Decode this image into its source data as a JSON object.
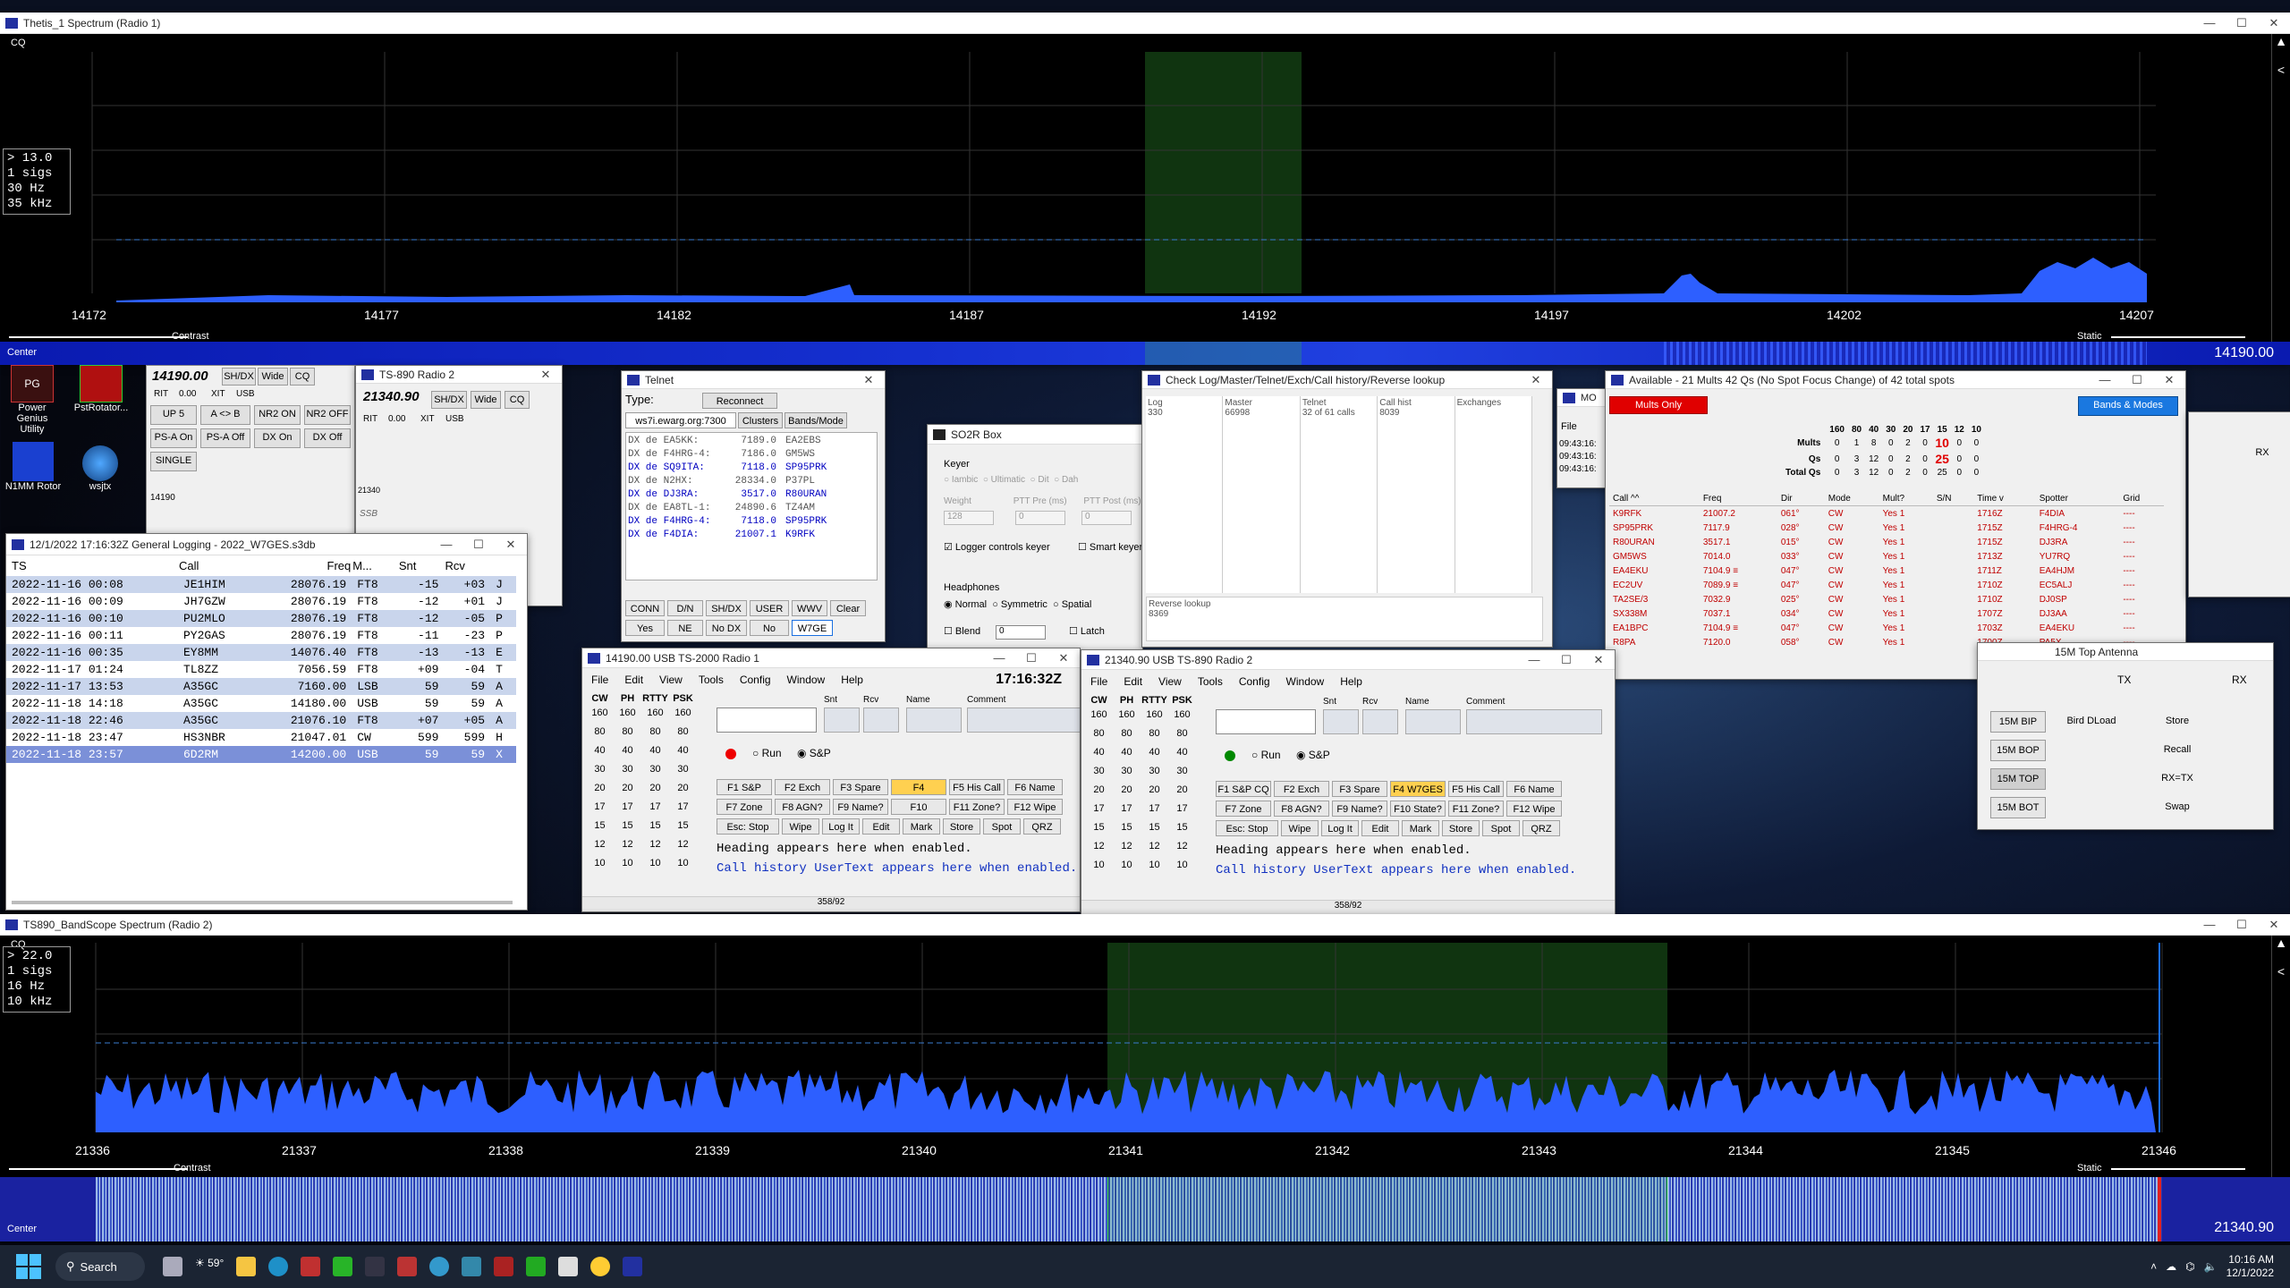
{
  "spectrum1": {
    "title": "Thetis_1 Spectrum (Radio 1)",
    "mode": "CQ",
    "info": [
      "> 13.0",
      "1 sigs",
      "30 Hz",
      "35 kHz"
    ],
    "ticks": [
      "14172",
      "14177",
      "14182",
      "14187",
      "14192",
      "14197",
      "14202",
      "14207"
    ],
    "contrast": "Contrast",
    "static": "Static",
    "center": "Center",
    "freq": "14190.00"
  },
  "radio1_mini": {
    "freq": "14190.00",
    "sh_dx": "SH/DX",
    "wide": "Wide",
    "cq": "CQ",
    "rit": "RIT",
    "rit_val": "0.00",
    "xit": "XIT",
    "mode": "USB",
    "buttons": [
      "UP 5",
      "A <> B",
      "NR2 ON",
      "NR2 OFF",
      "PS-A On",
      "PS-A Off",
      "DX On",
      "DX Off",
      "SINGLE"
    ],
    "marker": "14190"
  },
  "radio2_mini": {
    "title": "TS-890 Radio 2",
    "freq": "21340.90",
    "sh_dx": "SH/DX",
    "wide": "Wide",
    "cq": "CQ",
    "rit": "RIT",
    "rit_val": "0.00",
    "xit": "XIT",
    "mode": "USB",
    "marker": "21340",
    "ssb": "SSB"
  },
  "desktop_icons": [
    "Power Genius Utility",
    "PstRotator...",
    "N1MM Rotor",
    "wsjtx"
  ],
  "general_log": {
    "title": "12/1/2022 17:16:32Z  General Logging - 2022_W7GES.s3db",
    "columns": [
      "TS",
      "Call",
      "Freq",
      "M...",
      "Snt",
      "Rcv"
    ],
    "rows": [
      [
        "2022-11-16 00:08",
        "JE1HIM",
        "28076.19",
        "FT8",
        "-15",
        "+03",
        "J"
      ],
      [
        "2022-11-16 00:09",
        "JH7GZW",
        "28076.19",
        "FT8",
        "-12",
        "+01",
        "J"
      ],
      [
        "2022-11-16 00:10",
        "PU2MLO",
        "28076.19",
        "FT8",
        "-12",
        "-05",
        "P"
      ],
      [
        "2022-11-16 00:11",
        "PY2GAS",
        "28076.19",
        "FT8",
        "-11",
        "-23",
        "P"
      ],
      [
        "2022-11-16 00:35",
        "EY8MM",
        "14076.40",
        "FT8",
        "-13",
        "-13",
        "E"
      ],
      [
        "2022-11-17 01:24",
        "TL8ZZ",
        "7056.59",
        "FT8",
        "+09",
        "-04",
        "T"
      ],
      [
        "2022-11-17 13:53",
        "A35GC",
        "7160.00",
        "LSB",
        "59",
        "59",
        "A"
      ],
      [
        "2022-11-18 14:18",
        "A35GC",
        "14180.00",
        "USB",
        "59",
        "59",
        "A"
      ],
      [
        "2022-11-18 22:46",
        "A35GC",
        "21076.10",
        "FT8",
        "+07",
        "+05",
        "A"
      ],
      [
        "2022-11-18 23:47",
        "HS3NBR",
        "21047.01",
        "CW",
        "599",
        "599",
        "H"
      ],
      [
        "2022-11-18 23:57",
        "6D2RM",
        "14200.00",
        "USB",
        "59",
        "59",
        "X"
      ]
    ]
  },
  "telnet": {
    "title": "Telnet",
    "type_label": "Type:",
    "reconnect": "Reconnect",
    "tabs": [
      "ws7i.ewarg.org:7300",
      "Clusters",
      "Bands/Mode"
    ],
    "lines": [
      [
        "DX de EA5KK:",
        "7189.0",
        "EA2EBS"
      ],
      [
        "DX de F4HRG-4:",
        "7186.0",
        "GM5WS"
      ],
      [
        "DX de SQ9ITA:",
        "7118.0",
        "SP95PRK"
      ],
      [
        "DX de N2HX:",
        "28334.0",
        "P37PL"
      ],
      [
        "DX de DJ3RA:",
        "3517.0",
        "R80URAN"
      ],
      [
        "DX de EA8TL-1:",
        "24890.6",
        "TZ4AM"
      ],
      [
        "DX de F4HRG-4:",
        "7118.0",
        "SP95PRK"
      ],
      [
        "DX de F4DIA:",
        "21007.1",
        "K9RFK"
      ]
    ],
    "buttons": [
      "CONN",
      "D/N",
      "SH/DX",
      "USER",
      "WWV",
      "Clear",
      "Yes",
      "NE",
      "No DX",
      "No",
      "W7GE"
    ]
  },
  "so2r": {
    "title": "SO2R Box",
    "keyer": "Keyer",
    "keyer_opts": [
      "Iambic",
      "Ultimatic",
      "Dit",
      "Dah"
    ],
    "weight": "Weight",
    "ptt_pre": "PTT Pre (ms)",
    "ptt_post": "PTT Post (ms)",
    "weight_val": "128",
    "ptt_pre_val": "0",
    "ptt_post_val": "0",
    "logger_keyer": "Logger controls keyer",
    "smart_keyer": "Smart keyer",
    "headphones": "Headphones",
    "hp_opts": [
      "Normal",
      "Symmetric",
      "Spatial"
    ],
    "blend": "Blend",
    "blend_val": "0",
    "latch": "Latch"
  },
  "checklog": {
    "title": "Check Log/Master/Telnet/Exch/Call history/Reverse lookup",
    "cols": [
      [
        "Log",
        "330"
      ],
      [
        "Master",
        "66998"
      ],
      [
        "Telnet",
        "32 of 61 calls"
      ],
      [
        "Call hist",
        "8039"
      ],
      [
        "Exchanges",
        ""
      ]
    ],
    "reverse": "Reverse lookup",
    "reverse_val": "8369"
  },
  "available": {
    "title": "Available - 21 Mults 42 Qs  (No Spot Focus Change) of 42 total spots",
    "mults_only": "Mults Only",
    "bands_modes": "Bands & Modes",
    "band_hdr": [
      "160",
      "80",
      "40",
      "30",
      "20",
      "17",
      "15",
      "12",
      "10"
    ],
    "summary": [
      {
        "label": "Mults",
        "vals": [
          "0",
          "1",
          "8",
          "0",
          "2",
          "0",
          "10",
          "0",
          "0"
        ]
      },
      {
        "label": "Qs",
        "vals": [
          "0",
          "3",
          "12",
          "0",
          "2",
          "0",
          "25",
          "0",
          "0"
        ]
      },
      {
        "label": "Total Qs",
        "vals": [
          "0",
          "3",
          "12",
          "0",
          "2",
          "0",
          "25",
          "0",
          "0"
        ]
      }
    ],
    "columns": [
      "Call ^^",
      "Freq",
      "Dir",
      "Mode",
      "Mult?",
      "S/N",
      "Time v",
      "Spotter",
      "Grid"
    ],
    "rows": [
      [
        "K9RFK",
        "21007.2",
        "061°",
        "CW",
        "Yes 1",
        "",
        "1716Z",
        "F4DIA",
        "----"
      ],
      [
        "SP95PRK",
        "7117.9",
        "028°",
        "CW",
        "Yes 1",
        "",
        "1715Z",
        "F4HRG-4",
        "----"
      ],
      [
        "R80URAN",
        "3517.1",
        "015°",
        "CW",
        "Yes 1",
        "",
        "1715Z",
        "DJ3RA",
        "----"
      ],
      [
        "GM5WS",
        "7014.0",
        "033°",
        "CW",
        "Yes 1",
        "",
        "1713Z",
        "YU7RQ",
        "----"
      ],
      [
        "EA4EKU",
        "7104.9 ≡",
        "047°",
        "CW",
        "Yes 1",
        "",
        "1711Z",
        "EA4HJM",
        "----"
      ],
      [
        "EC2UV",
        "7089.9 ≡",
        "047°",
        "CW",
        "Yes 1",
        "",
        "1710Z",
        "EC5ALJ",
        "----"
      ],
      [
        "TA2SE/3",
        "7032.9",
        "025°",
        "CW",
        "Yes 1",
        "",
        "1710Z",
        "DJ0SP",
        "----"
      ],
      [
        "SX338M",
        "7037.1",
        "034°",
        "CW",
        "Yes 1",
        "",
        "1707Z",
        "DJ3AA",
        "----"
      ],
      [
        "EA1BPC",
        "7104.9 ≡",
        "047°",
        "CW",
        "Yes 1",
        "",
        "1703Z",
        "EA4EKU",
        "----"
      ],
      [
        "R8PA",
        "7120.0",
        "058°",
        "CW",
        "Yes 1",
        "",
        "1700Z",
        "PA5X",
        "----"
      ]
    ]
  },
  "bandmap_small": {
    "title": "MO",
    "file": "File",
    "times": [
      "09:43:16:",
      "09:43:16:",
      "09:43:16:"
    ]
  },
  "rxtx1": {
    "rx": "RX"
  },
  "rxtx2": {
    "title": "15M Top Antenna",
    "tx": "TX",
    "rx": "RX",
    "buttons": [
      "15M BIP",
      "15M BOP",
      "15M TOP",
      "15M BOT"
    ],
    "right": [
      "Bird DLoad",
      "Store",
      "Recall",
      "RX=TX",
      "Swap"
    ]
  },
  "entry1": {
    "title": "14190.00 USB TS-2000 Radio 1",
    "menu": [
      "File",
      "Edit",
      "View",
      "Tools",
      "Config",
      "Window",
      "Help"
    ],
    "time": "17:16:32Z",
    "band_cols": [
      "CW",
      "PH",
      "RTTY",
      "PSK"
    ],
    "bands": [
      "160",
      "80",
      "40",
      "30",
      "20",
      "17",
      "15",
      "12",
      "10"
    ],
    "labels": [
      "Snt",
      "Rcv",
      "Name",
      "Comment"
    ],
    "run": "Run",
    "sp": "S&P",
    "fkeys": [
      "F1 S&P",
      "F2 Exch",
      "F3 Spare",
      "F4",
      "F5 His Call",
      "F6 Name",
      "F7 Zone",
      "F8 AGN?",
      "F9 Name?",
      "F10",
      "F11 Zone?",
      "F12 Wipe",
      "Esc: Stop",
      "Wipe",
      "Log It",
      "Edit",
      "Mark",
      "Store",
      "Spot",
      "QRZ"
    ],
    "msg1": "Heading appears here when enabled.",
    "msg2": "Call history UserText appears here when enabled.",
    "status": "358/92"
  },
  "entry2": {
    "title": "21340.90 USB TS-890 Radio 2",
    "menu": [
      "File",
      "Edit",
      "View",
      "Tools",
      "Config",
      "Window",
      "Help"
    ],
    "band_cols": [
      "CW",
      "PH",
      "RTTY",
      "PSK"
    ],
    "bands": [
      "160",
      "80",
      "40",
      "30",
      "20",
      "17",
      "15",
      "12",
      "10"
    ],
    "labels": [
      "Snt",
      "Rcv",
      "Name",
      "Comment"
    ],
    "run": "Run",
    "sp": "S&P",
    "fkeys": [
      "F1 S&P CQ",
      "F2 Exch",
      "F3 Spare",
      "F4 W7GES",
      "F5 His Call",
      "F6 Name",
      "F7 Zone",
      "F8 AGN?",
      "F9 Name?",
      "F10 State?",
      "F11 Zone?",
      "F12 Wipe",
      "Esc: Stop",
      "Wipe",
      "Log It",
      "Edit",
      "Mark",
      "Store",
      "Spot",
      "QRZ"
    ],
    "msg1": "Heading appears here when enabled.",
    "msg2": "Call history UserText appears here when enabled.",
    "status": "358/92"
  },
  "spectrum2": {
    "title": "TS890_BandScope Spectrum (Radio 2)",
    "mode": "CQ",
    "info": [
      "> 22.0",
      "1 sigs",
      "16 Hz",
      "10 kHz"
    ],
    "ticks": [
      "21336",
      "21337",
      "21338",
      "21339",
      "21340",
      "21341",
      "21342",
      "21343",
      "21344",
      "21345",
      "21346"
    ],
    "contrast": "Contrast",
    "static": "Static",
    "center": "Center",
    "freq": "21340.90"
  },
  "taskbar": {
    "search": "Search",
    "weather": "59°",
    "time": "10:16 AM",
    "date": "12/1/2022"
  },
  "colors": {
    "spectrum_bg": "#000000",
    "signal": "#2d5fff",
    "highlight": "#123a12",
    "mults_red": "#c00000",
    "log_sel": "#7b90d8"
  }
}
